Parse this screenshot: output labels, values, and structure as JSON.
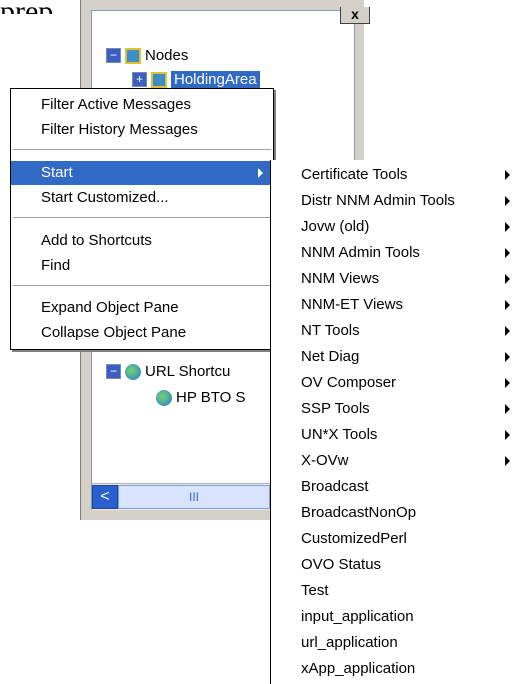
{
  "top_label": "prep",
  "panel": {
    "close_label": "x",
    "scroll_left_label": "<",
    "scroll_thumb_label": "III"
  },
  "tree": {
    "nodes_label": "Nodes",
    "holding_area_label": "HoldingArea",
    "url_shortcuts_label": "URL Shortcu",
    "hp_bto_label": "HP BTO S"
  },
  "context_menu": {
    "items": [
      {
        "label": "Filter Active Messages"
      },
      {
        "label": "Filter History Messages"
      },
      {
        "label": "Start"
      },
      {
        "label": "Start Customized..."
      },
      {
        "label": "Add to Shortcuts"
      },
      {
        "label": "Find"
      },
      {
        "label": "Expand Object Pane"
      },
      {
        "label": "Collapse Object Pane"
      }
    ]
  },
  "submenu": {
    "items": [
      {
        "label": "Certificate Tools",
        "has_submenu": true
      },
      {
        "label": "Distr NNM Admin Tools",
        "has_submenu": true
      },
      {
        "label": "Jovw (old)",
        "has_submenu": true
      },
      {
        "label": "NNM Admin Tools",
        "has_submenu": true
      },
      {
        "label": "NNM Views",
        "has_submenu": true
      },
      {
        "label": "NNM-ET Views",
        "has_submenu": true
      },
      {
        "label": "NT Tools",
        "has_submenu": true
      },
      {
        "label": "Net Diag",
        "has_submenu": true
      },
      {
        "label": "OV Composer",
        "has_submenu": true
      },
      {
        "label": "SSP Tools",
        "has_submenu": true
      },
      {
        "label": "UN*X Tools",
        "has_submenu": true
      },
      {
        "label": "X-OVw",
        "has_submenu": true
      },
      {
        "label": "Broadcast",
        "has_submenu": false
      },
      {
        "label": "BroadcastNonOp",
        "has_submenu": false
      },
      {
        "label": "CustomizedPerl",
        "has_submenu": false
      },
      {
        "label": "OVO Status",
        "has_submenu": false
      },
      {
        "label": "Test",
        "has_submenu": false
      },
      {
        "label": "input_application",
        "has_submenu": false
      },
      {
        "label": "url_application",
        "has_submenu": false
      },
      {
        "label": "xApp_application",
        "has_submenu": false
      }
    ]
  },
  "colors": {
    "selection": "#316ac5",
    "panel_bg": "#d4d0c8"
  }
}
